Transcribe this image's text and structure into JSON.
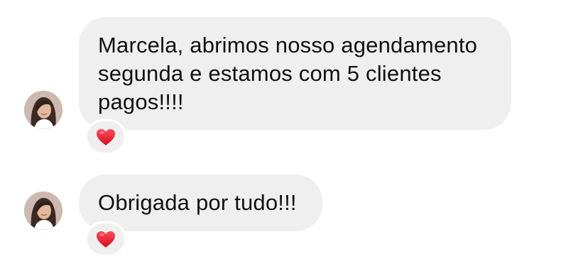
{
  "thread": {
    "messages": [
      {
        "text": "Marcela, abrimos nosso agendamento\nsegunda e estamos com 5 clientes\npagos!!!!",
        "reaction": "heart-icon"
      },
      {
        "text": "Obrigada por tudo!!!",
        "reaction": "heart-icon"
      }
    ],
    "colors": {
      "bubble": "#efeff0",
      "text": "#111111",
      "heart": "#e0182d",
      "background": "#ffffff"
    }
  }
}
